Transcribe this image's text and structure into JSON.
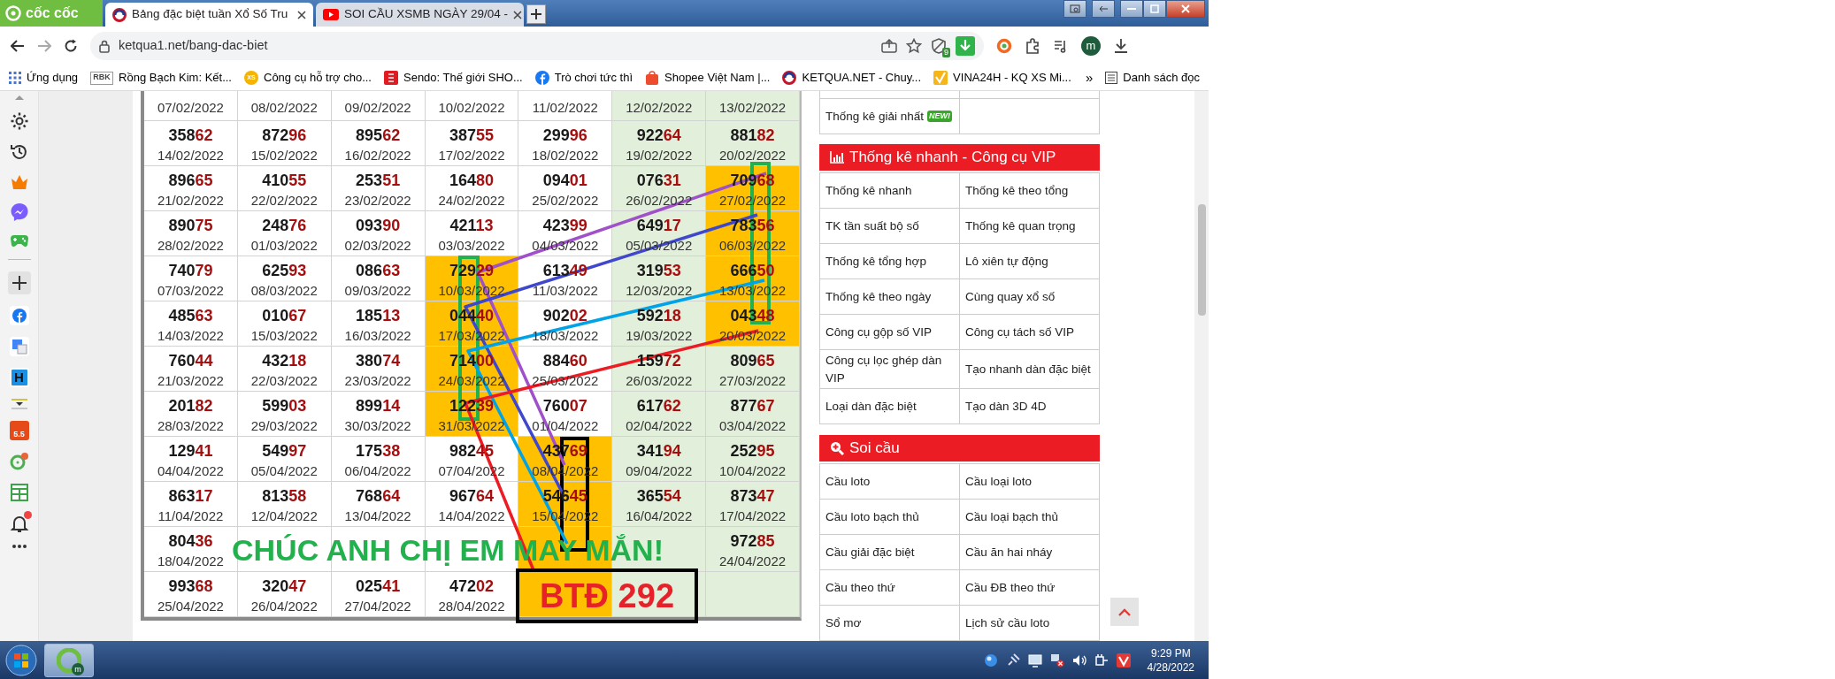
{
  "browser": {
    "brand": "cốc cốc",
    "tabs": [
      {
        "kind": "page",
        "title": "Bảng đặc biệt tuần Xổ Số Tru",
        "selected": true
      },
      {
        "kind": "video",
        "title": "SOI CẦU XSMB NGÀY 29/04 -",
        "selected": false
      }
    ],
    "address": "ketqua1.net/bang-dac-biet",
    "extension_badge": "9",
    "profile_initial": "m",
    "bookmarks": [
      {
        "kind": "apps",
        "label": "Ứng dụng"
      },
      {
        "kind": "tag",
        "icon_text": "RBK",
        "label": "Rồng Bạch Kim: Kết..."
      },
      {
        "kind": "coin",
        "icon_text": "XS",
        "label": "Công cụ hỗ trợ cho..."
      },
      {
        "kind": "sendo",
        "label": "Sendo: Thế giới SHO..."
      },
      {
        "kind": "facebook",
        "label": "Trò chơi tức thì"
      },
      {
        "kind": "bag",
        "label": "Shopee Việt Nam |..."
      },
      {
        "kind": "swirl",
        "label": "KETQUA.NET - Chuy..."
      },
      {
        "kind": "check",
        "label": "VINA24H - KQ XS Mi..."
      }
    ],
    "bookmarks_more": "»",
    "reading_list": "Danh sách đọc"
  },
  "app_rail": {
    "letter_app": "H",
    "shop_badge": "5.5",
    "notifications_unread": true
  },
  "lottery_table": {
    "columns": [
      {
        "shaded": false
      },
      {
        "shaded": false
      },
      {
        "shaded": false
      },
      {
        "shaded": false
      },
      {
        "shaded": false
      },
      {
        "shaded": true
      },
      {
        "shaded": true
      }
    ],
    "rows": [
      [
        {
          "date": "07/02/2022",
          "highlighted": false
        },
        {
          "date": "08/02/2022",
          "highlighted": false
        },
        {
          "date": "09/02/2022",
          "highlighted": false
        },
        {
          "date": "10/02/2022",
          "highlighted": false
        },
        {
          "date": "11/02/2022",
          "highlighted": false
        },
        {
          "date": "12/02/2022",
          "highlighted": false
        },
        {
          "date": "13/02/2022",
          "highlighted": false
        }
      ],
      [
        {
          "number": "35862",
          "date": "14/02/2022",
          "highlighted": false
        },
        {
          "number": "87296",
          "date": "15/02/2022",
          "highlighted": false
        },
        {
          "number": "89562",
          "date": "16/02/2022",
          "highlighted": false
        },
        {
          "number": "38755",
          "date": "17/02/2022",
          "highlighted": false
        },
        {
          "number": "29996",
          "date": "18/02/2022",
          "highlighted": false
        },
        {
          "number": "92264",
          "date": "19/02/2022",
          "highlighted": false
        },
        {
          "number": "88182",
          "date": "20/02/2022",
          "highlighted": false
        }
      ],
      [
        {
          "number": "89665",
          "date": "21/02/2022",
          "highlighted": false
        },
        {
          "number": "41055",
          "date": "22/02/2022",
          "highlighted": false
        },
        {
          "number": "25351",
          "date": "23/02/2022",
          "highlighted": false
        },
        {
          "number": "16480",
          "date": "24/02/2022",
          "highlighted": false
        },
        {
          "number": "09401",
          "date": "25/02/2022",
          "highlighted": false
        },
        {
          "number": "07631",
          "date": "26/02/2022",
          "highlighted": false
        },
        {
          "number": "70968",
          "date": "27/02/2022",
          "highlighted": true
        }
      ],
      [
        {
          "number": "89075",
          "date": "28/02/2022",
          "highlighted": false
        },
        {
          "number": "24876",
          "date": "01/03/2022",
          "highlighted": false
        },
        {
          "number": "09390",
          "date": "02/03/2022",
          "highlighted": false
        },
        {
          "number": "42113",
          "date": "03/03/2022",
          "highlighted": false
        },
        {
          "number": "42399",
          "date": "04/03/2022",
          "highlighted": false
        },
        {
          "number": "64917",
          "date": "05/03/2022",
          "highlighted": false
        },
        {
          "number": "78356",
          "date": "06/03/2022",
          "highlighted": true
        }
      ],
      [
        {
          "number": "74079",
          "date": "07/03/2022",
          "highlighted": false
        },
        {
          "number": "62593",
          "date": "08/03/2022",
          "highlighted": false
        },
        {
          "number": "08663",
          "date": "09/03/2022",
          "highlighted": false
        },
        {
          "number": "72929",
          "date": "10/03/2022",
          "highlighted": true
        },
        {
          "number": "61349",
          "date": "11/03/2022",
          "highlighted": false
        },
        {
          "number": "31953",
          "date": "12/03/2022",
          "highlighted": false
        },
        {
          "number": "66650",
          "date": "13/03/2022",
          "highlighted": true
        }
      ],
      [
        {
          "number": "48563",
          "date": "14/03/2022",
          "highlighted": false
        },
        {
          "number": "01067",
          "date": "15/03/2022",
          "highlighted": false
        },
        {
          "number": "18513",
          "date": "16/03/2022",
          "highlighted": false
        },
        {
          "number": "04440",
          "date": "17/03/2022",
          "highlighted": true
        },
        {
          "number": "90202",
          "date": "18/03/2022",
          "highlighted": false
        },
        {
          "number": "59218",
          "date": "19/03/2022",
          "highlighted": false
        },
        {
          "number": "04348",
          "date": "20/03/2022",
          "highlighted": true
        }
      ],
      [
        {
          "number": "76044",
          "date": "21/03/2022",
          "highlighted": false
        },
        {
          "number": "43218",
          "date": "22/03/2022",
          "highlighted": false
        },
        {
          "number": "38074",
          "date": "23/03/2022",
          "highlighted": false
        },
        {
          "number": "71400",
          "date": "24/03/2022",
          "highlighted": true
        },
        {
          "number": "88460",
          "date": "25/03/2022",
          "highlighted": false
        },
        {
          "number": "15972",
          "date": "26/03/2022",
          "highlighted": false
        },
        {
          "number": "80965",
          "date": "27/03/2022",
          "highlighted": false
        }
      ],
      [
        {
          "number": "20182",
          "date": "28/03/2022",
          "highlighted": false
        },
        {
          "number": "59903",
          "date": "29/03/2022",
          "highlighted": false
        },
        {
          "number": "89914",
          "date": "30/03/2022",
          "highlighted": false
        },
        {
          "number": "12239",
          "date": "31/03/2022",
          "highlighted": true
        },
        {
          "number": "76007",
          "date": "01/04/2022",
          "highlighted": false
        },
        {
          "number": "61762",
          "date": "02/04/2022",
          "highlighted": false
        },
        {
          "number": "87767",
          "date": "03/04/2022",
          "highlighted": false
        }
      ],
      [
        {
          "number": "12941",
          "date": "04/04/2022",
          "highlighted": false
        },
        {
          "number": "54997",
          "date": "05/04/2022",
          "highlighted": false
        },
        {
          "number": "17538",
          "date": "06/04/2022",
          "highlighted": false
        },
        {
          "number": "98245",
          "date": "07/04/2022",
          "highlighted": false
        },
        {
          "number": "43769",
          "date": "08/04/2022",
          "highlighted": true
        },
        {
          "number": "34194",
          "date": "09/04/2022",
          "highlighted": false
        },
        {
          "number": "25295",
          "date": "10/04/2022",
          "highlighted": false
        }
      ],
      [
        {
          "number": "86317",
          "date": "11/04/2022",
          "highlighted": false
        },
        {
          "number": "81358",
          "date": "12/04/2022",
          "highlighted": false
        },
        {
          "number": "76864",
          "date": "13/04/2022",
          "highlighted": false
        },
        {
          "number": "96764",
          "date": "14/04/2022",
          "highlighted": false
        },
        {
          "number": "54645",
          "date": "15/04/2022",
          "highlighted": true
        },
        {
          "number": "36554",
          "date": "16/04/2022",
          "highlighted": false
        },
        {
          "number": "87347",
          "date": "17/04/2022",
          "highlighted": false
        }
      ],
      [
        {
          "number": "80436",
          "date": "18/04/2022",
          "highlighted": false
        },
        {
          "highlighted": false
        },
        {
          "highlighted": false
        },
        {
          "highlighted": false
        },
        {
          "highlighted": true
        },
        {
          "highlighted": false
        },
        {
          "number": "97285",
          "date": "24/04/2022",
          "highlighted": false
        }
      ],
      [
        {
          "number": "99368",
          "date": "25/04/2022",
          "highlighted": false
        },
        {
          "number": "32047",
          "date": "26/04/2022",
          "highlighted": false
        },
        {
          "number": "02541",
          "date": "27/04/2022",
          "highlighted": false
        },
        {
          "number": "47202",
          "date": "28/04/2022",
          "highlighted": false
        },
        {
          "highlighted": true
        },
        {
          "highlighted": false
        },
        {
          "highlighted": false
        }
      ]
    ]
  },
  "sidebar": {
    "top_item": {
      "label": "Thống kê giải nhất",
      "badge": "NEW!"
    },
    "panels": [
      {
        "title": "Thống kê nhanh - Công cụ VIP",
        "items": [
          "Thống kê nhanh",
          "Thống kê theo tổng",
          "TK tần suất bộ số",
          "Thống kê quan trọng",
          "Thống kê tổng hợp",
          "Lô xiên tự động",
          "Thống kê theo ngày",
          "Cùng quay xổ số",
          "Công cụ gộp số VIP",
          "Công cụ tách số VIP",
          "Công cụ lọc ghép dàn VIP",
          "Tạo nhanh dàn đặc biệt",
          "Loại dàn đặc biệt",
          "Tạo dàn 3D 4D"
        ]
      },
      {
        "title": "Soi cầu",
        "items": [
          "Cầu loto",
          "Cầu loại loto",
          "Cầu loto bạch thủ",
          "Cầu loại bạch thủ",
          "Cầu giải đặc biệt",
          "Cầu ăn hai nháy",
          "Cầu theo thứ",
          "Cầu ĐB theo thứ",
          "Sổ mơ",
          "Lịch sử cầu loto"
        ]
      }
    ]
  },
  "annotation": {
    "greeting": "CHÚC ANH CHỊ EM MAY MẮN!",
    "result": "BTĐ 292"
  },
  "taskbar": {
    "app_badge": "m",
    "time": "9:29 PM",
    "date": "4/28/2022"
  }
}
